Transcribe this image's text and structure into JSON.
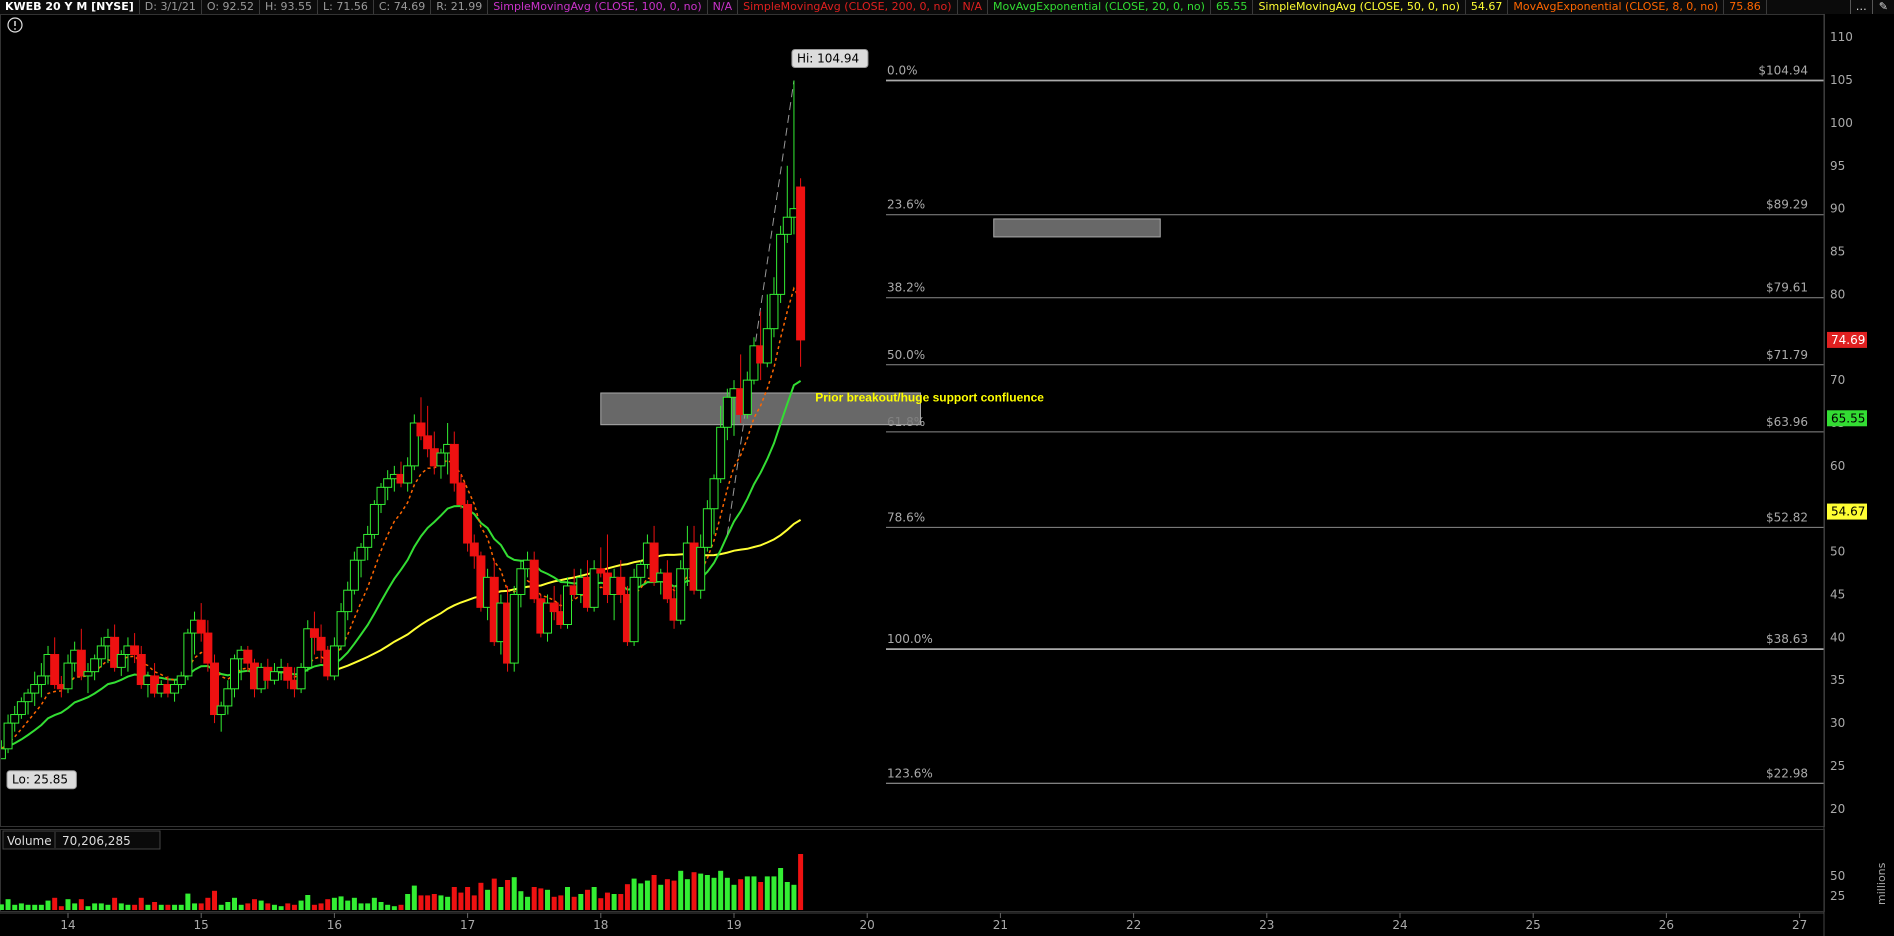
{
  "header": {
    "symbol": "KWEB 20 Y M [NYSE]",
    "date": "D: 3/1/21",
    "open": "O: 92.52",
    "high": "H: 93.55",
    "low": "L: 71.56",
    "close": "C: 74.69",
    "range": "R: 21.99",
    "studies": [
      {
        "label": "SimpleMovingAvg (CLOSE, 100, 0, no)",
        "value": "N/A",
        "color": "#cc33cc"
      },
      {
        "label": "SimpleMovingAvg (CLOSE, 200, 0, no)",
        "value": "N/A",
        "color": "#e02020"
      },
      {
        "label": "MovAvgExponential (CLOSE, 20, 0, no)",
        "value": "65.55",
        "color": "#33dd33"
      },
      {
        "label": "SimpleMovingAvg (CLOSE, 50, 0, no)",
        "value": "54.67",
        "color": "#ffff33"
      },
      {
        "label": "MovAvgExponential (CLOSE, 8, 0, no)",
        "value": "75.86",
        "color": "#ff6600"
      }
    ],
    "menu_icon": "dots-menu-icon"
  },
  "info_icon": "info-circle-icon",
  "chart_data": {
    "type": "candlestick",
    "symbol": "KWEB",
    "ylim": [
      18,
      112
    ],
    "y_ticks": [
      20,
      25,
      30,
      35,
      40,
      45,
      50,
      55,
      60,
      65,
      70,
      75,
      80,
      85,
      90,
      95,
      100,
      105,
      110
    ],
    "x_labels": [
      "14",
      "15",
      "16",
      "17",
      "18",
      "19",
      "20",
      "21",
      "22",
      "23",
      "24",
      "25",
      "26",
      "27"
    ],
    "hi_label": "Hi: 104.94",
    "lo_label": "Lo: 25.85",
    "annotation": "Prior breakout/huge support confluence",
    "price_badges": [
      {
        "value": "74.69",
        "color": "#e02020"
      },
      {
        "value": "65.55",
        "color": "#33dd33"
      },
      {
        "value": "54.67",
        "color": "#ffff33"
      }
    ],
    "fibonacci": [
      {
        "pct": "0.0%",
        "price": "$104.94",
        "value": 104.94
      },
      {
        "pct": "23.6%",
        "price": "$89.29",
        "value": 89.29
      },
      {
        "pct": "38.2%",
        "price": "$79.61",
        "value": 79.61
      },
      {
        "pct": "50.0%",
        "price": "$71.79",
        "value": 71.79
      },
      {
        "pct": "61.8%",
        "price": "$63.96",
        "value": 63.96
      },
      {
        "pct": "78.6%",
        "price": "$52.82",
        "value": 52.82
      },
      {
        "pct": "100.0%",
        "price": "$38.63",
        "value": 38.63
      },
      {
        "pct": "123.6%",
        "price": "$22.98",
        "value": 22.98
      }
    ],
    "zones": [
      {
        "name": "support-zone",
        "x_from": 18.0,
        "x_to": 20.4,
        "y_from": 64.8,
        "y_to": 68.5
      },
      {
        "name": "gap-zone",
        "x_from": 20.95,
        "x_to": 22.2,
        "y_from": 86.7,
        "y_to": 88.8
      }
    ],
    "candles": [
      [
        13.5,
        25.85,
        28,
        25.85,
        27
      ],
      [
        13.55,
        27,
        31,
        26.5,
        30
      ],
      [
        13.6,
        30,
        32,
        29,
        31
      ],
      [
        13.65,
        31,
        33,
        30.5,
        32.5
      ],
      [
        13.7,
        32.5,
        34,
        31,
        33.5
      ],
      [
        13.75,
        33.5,
        36,
        32,
        34.5
      ],
      [
        13.8,
        34.5,
        37,
        33,
        35.5
      ],
      [
        13.85,
        35.5,
        39,
        34.5,
        38
      ],
      [
        13.9,
        38,
        40,
        34,
        34.5
      ],
      [
        13.95,
        34.5,
        35.5,
        33,
        34
      ],
      [
        14.0,
        34,
        38,
        33.5,
        37
      ],
      [
        14.05,
        37,
        39.5,
        36,
        38.5
      ],
      [
        14.1,
        38.5,
        41,
        35,
        35.5
      ],
      [
        14.15,
        35.5,
        37,
        33.5,
        36
      ],
      [
        14.2,
        36,
        38,
        35,
        37.5
      ],
      [
        14.25,
        37.5,
        40,
        36.5,
        39
      ],
      [
        14.3,
        39,
        41,
        37,
        40
      ],
      [
        14.35,
        40,
        41.5,
        36,
        36.5
      ],
      [
        14.4,
        36.5,
        38.5,
        35.5,
        38
      ],
      [
        14.45,
        38,
        40,
        36,
        39
      ],
      [
        14.5,
        39,
        40.5,
        37,
        38
      ],
      [
        14.55,
        38,
        39,
        34,
        34.5
      ],
      [
        14.6,
        34.5,
        36,
        33,
        35.5
      ],
      [
        14.65,
        35.5,
        37,
        33,
        33.5
      ],
      [
        14.7,
        33.5,
        35,
        33,
        34.5
      ],
      [
        14.75,
        34.5,
        35.5,
        33,
        33.5
      ],
      [
        14.8,
        33.5,
        35,
        32.5,
        34.5
      ],
      [
        14.85,
        34.5,
        36,
        34,
        35.5
      ],
      [
        14.9,
        35.5,
        41,
        35,
        40.5
      ],
      [
        14.95,
        40.5,
        43,
        38,
        42
      ],
      [
        15.0,
        42,
        44,
        39.5,
        40.5
      ],
      [
        15.05,
        40.5,
        42,
        36,
        37
      ],
      [
        15.1,
        37,
        38,
        30,
        31
      ],
      [
        15.15,
        31,
        32.5,
        29,
        32
      ],
      [
        15.2,
        32,
        35,
        31,
        34
      ],
      [
        15.25,
        34,
        38,
        33,
        37.5
      ],
      [
        15.3,
        37.5,
        39,
        35,
        38.5
      ],
      [
        15.35,
        38.5,
        39,
        36,
        37
      ],
      [
        15.4,
        37,
        37.5,
        33,
        34
      ],
      [
        15.45,
        34,
        37,
        33.5,
        36.5
      ],
      [
        15.5,
        36.5,
        37.5,
        34,
        35
      ],
      [
        15.55,
        35,
        37,
        34.5,
        36
      ],
      [
        15.6,
        36,
        37.5,
        35,
        36.5
      ],
      [
        15.65,
        36.5,
        37,
        34,
        35
      ],
      [
        15.7,
        35,
        36.5,
        33,
        34
      ],
      [
        15.75,
        34,
        37,
        33.5,
        36.5
      ],
      [
        15.8,
        36.5,
        42,
        36,
        41
      ],
      [
        15.85,
        41,
        43,
        38,
        40
      ],
      [
        15.9,
        40,
        41.5,
        37,
        38.5
      ],
      [
        15.95,
        38.5,
        39,
        35,
        35.5
      ],
      [
        16.0,
        35.5,
        40,
        35,
        39
      ],
      [
        16.05,
        39,
        44,
        38.5,
        43
      ],
      [
        16.1,
        43,
        46.5,
        42,
        45.5
      ],
      [
        16.15,
        45.5,
        50,
        45,
        49
      ],
      [
        16.2,
        49,
        51,
        47,
        50.5
      ],
      [
        16.25,
        50.5,
        53,
        49,
        52
      ],
      [
        16.3,
        52,
        56,
        51.5,
        55.5
      ],
      [
        16.35,
        55.5,
        58,
        54.5,
        57.5
      ],
      [
        16.4,
        57.5,
        59.5,
        56,
        58.5
      ],
      [
        16.45,
        58.5,
        60,
        57,
        59
      ],
      [
        16.5,
        59,
        60.5,
        57.5,
        58
      ],
      [
        16.55,
        58,
        61,
        57,
        60
      ],
      [
        16.6,
        60,
        66,
        59.5,
        65
      ],
      [
        16.65,
        65,
        68,
        63,
        63.5
      ],
      [
        16.7,
        63.5,
        67,
        61,
        62
      ],
      [
        16.75,
        62,
        64,
        59,
        60
      ],
      [
        16.8,
        60,
        62,
        58.5,
        61.5
      ],
      [
        16.85,
        61.5,
        65,
        59,
        62.5
      ],
      [
        16.9,
        62.5,
        64,
        57,
        58
      ],
      [
        16.95,
        58,
        59,
        55,
        55.5
      ],
      [
        17.0,
        55.5,
        56,
        50,
        51
      ],
      [
        17.05,
        51,
        52,
        48,
        49.5
      ],
      [
        17.1,
        49.5,
        50,
        43,
        43.5
      ],
      [
        17.15,
        43.5,
        48,
        42,
        47
      ],
      [
        17.2,
        47,
        49,
        39,
        39.5
      ],
      [
        17.25,
        39.5,
        45,
        38,
        44
      ],
      [
        17.3,
        44,
        46,
        36,
        37
      ],
      [
        17.35,
        37,
        46,
        36,
        45
      ],
      [
        17.4,
        45,
        49,
        43.5,
        48
      ],
      [
        17.45,
        48,
        50,
        47,
        49
      ],
      [
        17.5,
        49,
        50,
        44,
        44.5
      ],
      [
        17.55,
        44.5,
        45,
        40,
        40.5
      ],
      [
        17.6,
        40.5,
        45,
        39.5,
        44
      ],
      [
        17.65,
        44,
        46,
        42,
        43
      ],
      [
        17.7,
        43,
        45,
        41,
        41.5
      ],
      [
        17.75,
        41.5,
        47,
        41,
        46
      ],
      [
        17.8,
        46,
        48,
        44.5,
        45
      ],
      [
        17.85,
        45,
        48,
        44,
        47
      ],
      [
        17.9,
        47,
        49,
        43,
        43.5
      ],
      [
        17.95,
        43.5,
        49,
        43,
        48
      ],
      [
        18.0,
        48,
        50.5,
        47,
        47.5
      ],
      [
        18.05,
        47.5,
        52,
        44,
        45
      ],
      [
        18.1,
        45,
        48,
        42,
        47
      ],
      [
        18.15,
        47,
        49,
        44,
        45
      ],
      [
        18.2,
        45,
        46,
        39,
        39.5
      ],
      [
        18.25,
        39.5,
        48,
        39,
        47
      ],
      [
        18.3,
        47,
        49,
        46,
        48.5
      ],
      [
        18.35,
        48.5,
        52,
        48,
        51
      ],
      [
        18.4,
        51,
        53,
        46,
        46.5
      ],
      [
        18.45,
        46.5,
        48,
        45,
        47.5
      ],
      [
        18.5,
        47.5,
        49,
        44,
        44.5
      ],
      [
        18.55,
        44.5,
        46,
        41,
        42
      ],
      [
        18.6,
        42,
        49,
        41.5,
        48
      ],
      [
        18.65,
        48,
        53,
        46,
        51
      ],
      [
        18.7,
        51,
        53,
        45,
        45.5
      ],
      [
        18.75,
        45.5,
        52,
        44.5,
        50.5
      ],
      [
        18.8,
        50.5,
        56,
        50,
        55
      ],
      [
        18.85,
        55,
        59,
        52,
        58.5
      ],
      [
        18.9,
        58.5,
        67,
        58,
        64.5
      ],
      [
        18.95,
        64.5,
        69,
        63,
        68
      ],
      [
        19.0,
        68,
        70,
        63.5,
        69
      ],
      [
        19.05,
        69,
        73,
        65,
        66
      ],
      [
        19.1,
        66,
        71,
        65.5,
        70
      ],
      [
        19.15,
        70,
        75,
        69.5,
        74
      ],
      [
        19.2,
        74,
        78,
        70,
        72
      ],
      [
        19.25,
        72,
        80,
        71.5,
        76
      ],
      [
        19.3,
        76,
        82,
        75,
        80
      ],
      [
        19.35,
        80,
        88,
        79,
        87
      ],
      [
        19.4,
        87,
        95,
        86,
        89
      ],
      [
        19.45,
        89,
        104.94,
        87,
        90
      ],
      [
        19.5,
        92.52,
        93.55,
        71.56,
        74.69
      ]
    ],
    "volume": {
      "label": "Volume",
      "value": "70,206,285",
      "ylim": [
        0,
        75
      ],
      "y_ticks": [
        25,
        50
      ],
      "unit_label": "millions"
    }
  }
}
